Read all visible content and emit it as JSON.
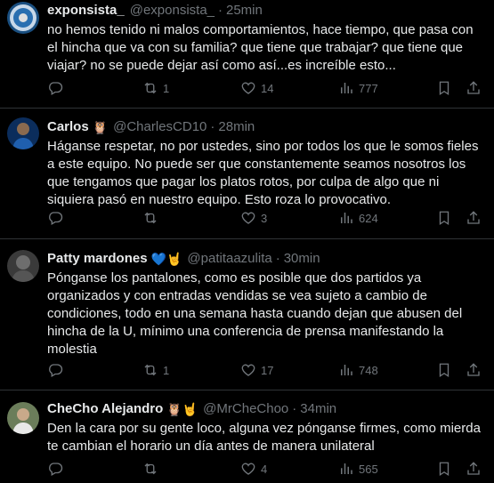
{
  "tweets": [
    {
      "name": "exponsista_",
      "handle": "@exponsista_",
      "time": "25min",
      "emoji": "",
      "text": "no hemos tenido ni malos comportamientos, hace tiempo, que pasa con el hincha que va con su familia? que tiene que trabajar? que tiene que viajar? no se puede dejar así como así...es increíble esto...",
      "retweets": "1",
      "likes": "14",
      "views": "777",
      "replies": ""
    },
    {
      "name": "Carlos",
      "handle": "@CharlesCD10",
      "time": "28min",
      "emoji": "🦉",
      "text": "Háganse respetar, no por ustedes, sino por todos los que le somos fieles a este equipo. No puede ser que constantemente seamos nosotros los que tengamos que pagar los platos rotos, por culpa de algo que ni siquiera pasó en nuestro equipo. Esto roza lo provocativo.",
      "retweets": "",
      "likes": "3",
      "views": "624",
      "replies": ""
    },
    {
      "name": "Patty mardones",
      "handle": "@patitaazulita",
      "time": "30min",
      "emoji": "💙🤘",
      "text": "Pónganse los pantalones, como es posible que dos partidos ya organizados y con entradas vendidas se vea sujeto a cambio de condiciones, todo en una semana hasta cuando dejan que abusen del hincha de la U, mínimo una conferencia de prensa manifestando la molestia",
      "retweets": "1",
      "likes": "17",
      "views": "748",
      "replies": ""
    },
    {
      "name": "CheCho Alejandro",
      "handle": "@MrCheChoo",
      "time": "34min",
      "emoji": "🦉🤘",
      "text": "Den la cara por su gente loco, alguna vez pónganse firmes, como mierda te cambian el horario un día antes de manera unilateral",
      "retweets": "",
      "likes": "4",
      "views": "565",
      "replies": ""
    }
  ],
  "separator": "·",
  "colors": {
    "background": "#000000",
    "text": "#e7e9ea",
    "muted": "#71767b",
    "border": "#2f3336"
  }
}
